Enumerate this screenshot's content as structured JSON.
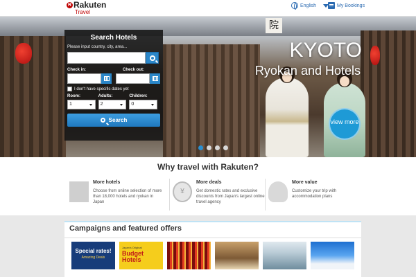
{
  "header": {
    "brand": "Rakuten",
    "brand_sub": "Travel",
    "language": "English",
    "bookings": "My Bookings"
  },
  "hero": {
    "sign_char": "院",
    "title": "KYOTO",
    "subtitle": "Ryokan and Hotels",
    "view_more": "view more",
    "slides": 4,
    "active_slide": 1
  },
  "search": {
    "title": "Search Hotels",
    "destination_placeholder": "Please input country, city, area...",
    "checkin_label": "Check in:",
    "checkout_label": "Check out:",
    "no_dates_label": "I don't have specific dates yet",
    "room_label": "Room:",
    "adults_label": "Adults:",
    "children_label": "Children:",
    "room_value": "1",
    "adults_value": "2",
    "children_value": "0",
    "button": "Search"
  },
  "why": {
    "title": "Why travel with Rakuten?",
    "features": [
      {
        "title": "More hotels",
        "text": "Choose from online selection of more than 18,000 hotels and ryokan in Japan"
      },
      {
        "title": "More deals",
        "text": "Get domestic rates and exclusive discounts from Japan's largest online travel agency"
      },
      {
        "title": "More value",
        "text": "Customize your trip with accommodation plans"
      }
    ]
  },
  "campaigns": {
    "title": "Campaigns and featured offers",
    "thumb1_title": "Special rates!",
    "thumb1_sub": "Amazing Deals",
    "thumb2_small": "Japan's Original",
    "thumb2_title": "Budget Hotels"
  }
}
